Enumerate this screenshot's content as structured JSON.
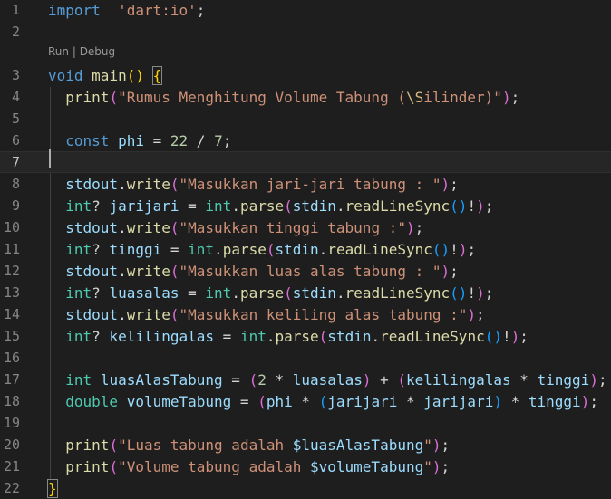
{
  "editor": {
    "language": "dart",
    "active_line": 7,
    "codelens": {
      "run": "Run",
      "separator": " | ",
      "debug": "Debug"
    },
    "lines": [
      {
        "n": "1",
        "tokens": [
          [
            "kw",
            "import"
          ],
          [
            "",
            "  "
          ],
          [
            "str",
            "'dart:io'"
          ],
          [
            "",
            ";"
          ]
        ]
      },
      {
        "n": "2",
        "tokens": []
      },
      {
        "n": "3",
        "tokens": [
          [
            "kw",
            "void"
          ],
          [
            "",
            " "
          ],
          [
            "fn",
            "main"
          ],
          [
            "p1",
            "()"
          ],
          [
            "",
            " "
          ],
          [
            "p1 brmatch",
            "{"
          ]
        ]
      },
      {
        "n": "4",
        "tokens": [
          [
            "",
            "  "
          ],
          [
            "fn",
            "print"
          ],
          [
            "p2",
            "("
          ],
          [
            "str",
            "\"Rumus Menghitung Volume Tabung ("
          ],
          [
            "esc",
            "\\S"
          ],
          [
            "str",
            "ilinder)\""
          ],
          [
            "p2",
            ")"
          ],
          [
            "",
            ";"
          ]
        ]
      },
      {
        "n": "5",
        "tokens": []
      },
      {
        "n": "6",
        "tokens": [
          [
            "",
            "  "
          ],
          [
            "kw",
            "const"
          ],
          [
            "",
            " "
          ],
          [
            "var",
            "phi"
          ],
          [
            "",
            " = "
          ],
          [
            "num",
            "22"
          ],
          [
            "",
            " / "
          ],
          [
            "num",
            "7"
          ],
          [
            "",
            ";"
          ]
        ]
      },
      {
        "n": "7",
        "tokens": []
      },
      {
        "n": "8",
        "tokens": [
          [
            "",
            "  "
          ],
          [
            "var",
            "stdout"
          ],
          [
            "",
            "."
          ],
          [
            "fn",
            "write"
          ],
          [
            "p2",
            "("
          ],
          [
            "str",
            "\"Masukkan jari-jari tabung : \""
          ],
          [
            "p2",
            ")"
          ],
          [
            "",
            ";"
          ]
        ]
      },
      {
        "n": "9",
        "tokens": [
          [
            "",
            "  "
          ],
          [
            "typ",
            "int"
          ],
          [
            "",
            "? "
          ],
          [
            "var",
            "jarijari"
          ],
          [
            "",
            " = "
          ],
          [
            "typ",
            "int"
          ],
          [
            "",
            "."
          ],
          [
            "fn",
            "parse"
          ],
          [
            "p2",
            "("
          ],
          [
            "var",
            "stdin"
          ],
          [
            "",
            "."
          ],
          [
            "fn",
            "readLineSync"
          ],
          [
            "p3",
            "()"
          ],
          [
            "",
            "!"
          ],
          [
            "p2",
            ")"
          ],
          [
            "",
            ";"
          ]
        ]
      },
      {
        "n": "10",
        "tokens": [
          [
            "",
            "  "
          ],
          [
            "var",
            "stdout"
          ],
          [
            "",
            "."
          ],
          [
            "fn",
            "write"
          ],
          [
            "p2",
            "("
          ],
          [
            "str",
            "\"Masukkan tinggi tabung :\""
          ],
          [
            "p2",
            ")"
          ],
          [
            "",
            ";"
          ]
        ]
      },
      {
        "n": "11",
        "tokens": [
          [
            "",
            "  "
          ],
          [
            "typ",
            "int"
          ],
          [
            "",
            "? "
          ],
          [
            "var",
            "tinggi"
          ],
          [
            "",
            " = "
          ],
          [
            "typ",
            "int"
          ],
          [
            "",
            "."
          ],
          [
            "fn",
            "parse"
          ],
          [
            "p2",
            "("
          ],
          [
            "var",
            "stdin"
          ],
          [
            "",
            "."
          ],
          [
            "fn",
            "readLineSync"
          ],
          [
            "p3",
            "()"
          ],
          [
            "",
            "!"
          ],
          [
            "p2",
            ")"
          ],
          [
            "",
            ";"
          ]
        ]
      },
      {
        "n": "12",
        "tokens": [
          [
            "",
            "  "
          ],
          [
            "var",
            "stdout"
          ],
          [
            "",
            "."
          ],
          [
            "fn",
            "write"
          ],
          [
            "p2",
            "("
          ],
          [
            "str",
            "\"Masukkan luas alas tabung : \""
          ],
          [
            "p2",
            ")"
          ],
          [
            "",
            ";"
          ]
        ]
      },
      {
        "n": "13",
        "tokens": [
          [
            "",
            "  "
          ],
          [
            "typ",
            "int"
          ],
          [
            "",
            "? "
          ],
          [
            "var",
            "luasalas"
          ],
          [
            "",
            " = "
          ],
          [
            "typ",
            "int"
          ],
          [
            "",
            "."
          ],
          [
            "fn",
            "parse"
          ],
          [
            "p2",
            "("
          ],
          [
            "var",
            "stdin"
          ],
          [
            "",
            "."
          ],
          [
            "fn",
            "readLineSync"
          ],
          [
            "p3",
            "()"
          ],
          [
            "",
            "!"
          ],
          [
            "p2",
            ")"
          ],
          [
            "",
            ";"
          ]
        ]
      },
      {
        "n": "14",
        "tokens": [
          [
            "",
            "  "
          ],
          [
            "var",
            "stdout"
          ],
          [
            "",
            "."
          ],
          [
            "fn",
            "write"
          ],
          [
            "p2",
            "("
          ],
          [
            "str",
            "\"Masukkan keliling alas tabung :\""
          ],
          [
            "p2",
            ")"
          ],
          [
            "",
            ";"
          ]
        ]
      },
      {
        "n": "15",
        "tokens": [
          [
            "",
            "  "
          ],
          [
            "typ",
            "int"
          ],
          [
            "",
            "? "
          ],
          [
            "var",
            "kelilingalas"
          ],
          [
            "",
            " = "
          ],
          [
            "typ",
            "int"
          ],
          [
            "",
            "."
          ],
          [
            "fn",
            "parse"
          ],
          [
            "p2",
            "("
          ],
          [
            "var",
            "stdin"
          ],
          [
            "",
            "."
          ],
          [
            "fn",
            "readLineSync"
          ],
          [
            "p3",
            "()"
          ],
          [
            "",
            "!"
          ],
          [
            "p2",
            ")"
          ],
          [
            "",
            ";"
          ]
        ]
      },
      {
        "n": "16",
        "tokens": []
      },
      {
        "n": "17",
        "tokens": [
          [
            "",
            "  "
          ],
          [
            "typ",
            "int"
          ],
          [
            "",
            " "
          ],
          [
            "var",
            "luasAlasTabung"
          ],
          [
            "",
            " = "
          ],
          [
            "p2",
            "("
          ],
          [
            "num",
            "2"
          ],
          [
            "",
            " * "
          ],
          [
            "var",
            "luasalas"
          ],
          [
            "p2",
            ")"
          ],
          [
            "",
            " + "
          ],
          [
            "p2",
            "("
          ],
          [
            "var",
            "kelilingalas"
          ],
          [
            "",
            " * "
          ],
          [
            "var",
            "tinggi"
          ],
          [
            "p2",
            ")"
          ],
          [
            "",
            ";"
          ]
        ]
      },
      {
        "n": "18",
        "tokens": [
          [
            "",
            "  "
          ],
          [
            "typ",
            "double"
          ],
          [
            "",
            " "
          ],
          [
            "var",
            "volumeTabung"
          ],
          [
            "",
            " = "
          ],
          [
            "p2",
            "("
          ],
          [
            "var",
            "phi"
          ],
          [
            "",
            " * "
          ],
          [
            "p3",
            "("
          ],
          [
            "var",
            "jarijari"
          ],
          [
            "",
            " * "
          ],
          [
            "var",
            "jarijari"
          ],
          [
            "p3",
            ")"
          ],
          [
            "",
            " * "
          ],
          [
            "var",
            "tinggi"
          ],
          [
            "p2",
            ")"
          ],
          [
            "",
            ";"
          ]
        ]
      },
      {
        "n": "19",
        "tokens": []
      },
      {
        "n": "20",
        "tokens": [
          [
            "",
            "  "
          ],
          [
            "fn",
            "print"
          ],
          [
            "p2",
            "("
          ],
          [
            "str",
            "\"Luas tabung adalah "
          ],
          [
            "var",
            "$luasAlasTabung"
          ],
          [
            "str",
            "\""
          ],
          [
            "p2",
            ")"
          ],
          [
            "",
            ";"
          ]
        ]
      },
      {
        "n": "21",
        "tokens": [
          [
            "",
            "  "
          ],
          [
            "fn",
            "print"
          ],
          [
            "p2",
            "("
          ],
          [
            "str",
            "\"Volume tabung adalah "
          ],
          [
            "var",
            "$volumeTabung"
          ],
          [
            "str",
            "\""
          ],
          [
            "p2",
            ")"
          ],
          [
            "",
            ";"
          ]
        ]
      },
      {
        "n": "22",
        "tokens": [
          [
            "p1 brmatch",
            "}"
          ]
        ]
      }
    ]
  }
}
